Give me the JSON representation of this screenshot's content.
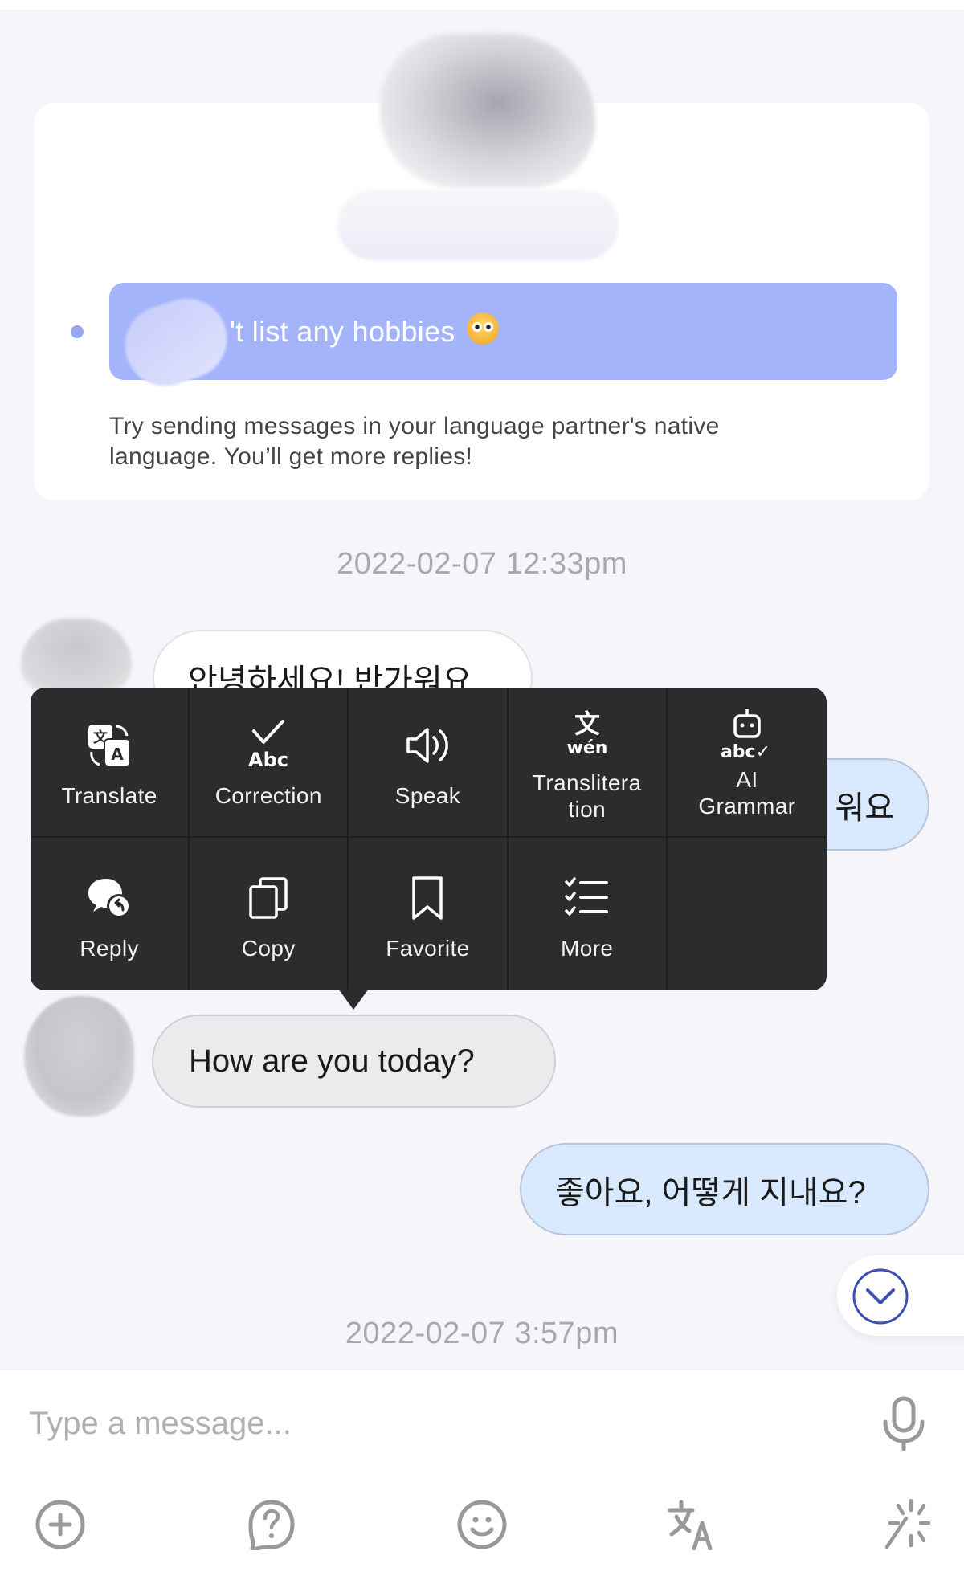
{
  "profile_card": {
    "hobby_message": "'t list any hobbies",
    "hobby_emoji": "flushed-face-emoji",
    "tip": "Try sending messages in your language partner's native language. You’ll get more replies!"
  },
  "timestamps": [
    "2022-02-07 12:33pm",
    "2022-02-07 3:57pm"
  ],
  "messages": [
    {
      "side": "incoming",
      "text": "안녕하세요! 반가워요"
    },
    {
      "side": "outgoing",
      "text": "워요"
    },
    {
      "side": "incoming",
      "text": "How are you today?"
    },
    {
      "side": "outgoing",
      "text": "좋아요, 어떻게 지내요?"
    }
  ],
  "context_menu": {
    "items": [
      {
        "label": "Translate",
        "icon": "translate-icon"
      },
      {
        "label": "Correction",
        "icon": "correction-icon"
      },
      {
        "label": "Speak",
        "icon": "speaker-icon"
      },
      {
        "label": "Transliteration",
        "label_display": "Translitera\ntion",
        "icon": "transliteration-icon"
      },
      {
        "label": "AI Grammar",
        "label_display": "AI\nGrammar",
        "icon": "ai-grammar-icon"
      },
      {
        "label": "Reply",
        "icon": "reply-icon"
      },
      {
        "label": "Copy",
        "icon": "copy-icon"
      },
      {
        "label": "Favorite",
        "icon": "bookmark-icon"
      },
      {
        "label": "More",
        "icon": "checklist-icon"
      }
    ]
  },
  "composer": {
    "placeholder": "Type a message...",
    "value": "",
    "toolbar": [
      "plus-icon",
      "help-icon",
      "emoji-icon",
      "translate-icon",
      "magic-icon"
    ]
  },
  "colors": {
    "accent": "#3d4fb0",
    "hobby_bar": "#a4b4fa",
    "outgoing_bubble": "#d9e9fd",
    "menu_bg": "#2c2c2e"
  }
}
